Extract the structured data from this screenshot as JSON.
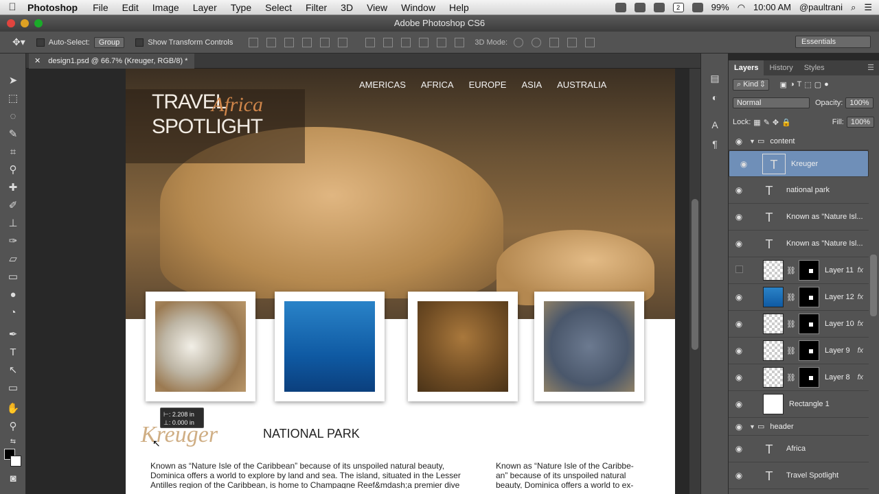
{
  "menubar": {
    "apple": "",
    "app": "Photoshop",
    "items": [
      "File",
      "Edit",
      "Image",
      "Layer",
      "Type",
      "Select",
      "Filter",
      "3D",
      "View",
      "Window",
      "Help"
    ],
    "battery": "99%",
    "time": "10:00 AM",
    "user": "@paultrani",
    "badge": "2"
  },
  "window": {
    "title": "Adobe Photoshop CS6"
  },
  "options": {
    "autoselect_label": "Auto-Select:",
    "autoselect_value": "Group",
    "transform_label": "Show Transform Controls",
    "mode3d": "3D Mode:",
    "workspace": "Essentials"
  },
  "document": {
    "tab": "design1.psd @ 66.7% (Kreuger, RGB/8) *",
    "logo_a": "TRAVEL",
    "logo_b": "Africa",
    "logo_c": "SPOTLIGHT",
    "nav": [
      "AMERICAS",
      "AFRICA",
      "EUROPE",
      "ASIA",
      "AUSTRALIA"
    ],
    "kreuger": "Kreuger",
    "national_park": "NATIONAL PARK",
    "para1": "Known as “Nature Isle of the Caribbean” because of its unspoiled natural beauty, Dominica offers a world to explore by land and sea. The island, situated in the Lesser Antilles region of the Caribbean, is home to Champagne Reef&mdash;a premier dive",
    "para2": "Known as “Nature Isle of the Caribbe- an” because of its unspoiled natural beauty, Dominica offers a world to ex-",
    "tooltip_w": "⊢: 2.208 in",
    "tooltip_h": "⊥: 0.000 in"
  },
  "panel": {
    "tabs": [
      "Layers",
      "History",
      "Styles"
    ],
    "filter": "Kind",
    "blend": "Normal",
    "opacity_label": "Opacity:",
    "opacity": "100%",
    "lock_label": "Lock:",
    "fill_label": "Fill:",
    "fill": "100%",
    "fx": "fx",
    "layers": [
      {
        "name": "content",
        "kind": "group"
      },
      {
        "name": "Kreuger",
        "kind": "text",
        "selected": true
      },
      {
        "name": "national park",
        "kind": "text"
      },
      {
        "name": "Known as \"Nature Isl...",
        "kind": "text"
      },
      {
        "name": "Known as \"Nature Isl...",
        "kind": "text"
      },
      {
        "name": "Layer 11",
        "kind": "image"
      },
      {
        "name": "Layer 12",
        "kind": "image"
      },
      {
        "name": "Layer 10",
        "kind": "image"
      },
      {
        "name": "Layer 9",
        "kind": "image"
      },
      {
        "name": "Layer 8",
        "kind": "image"
      },
      {
        "name": "Rectangle 1",
        "kind": "shape"
      },
      {
        "name": "header",
        "kind": "group"
      },
      {
        "name": "Africa",
        "kind": "text"
      },
      {
        "name": "Travel Spotlight",
        "kind": "text"
      }
    ]
  },
  "colors": {
    "accent_selected": "#6f8fb8",
    "logo_orange": "#d0864a"
  }
}
